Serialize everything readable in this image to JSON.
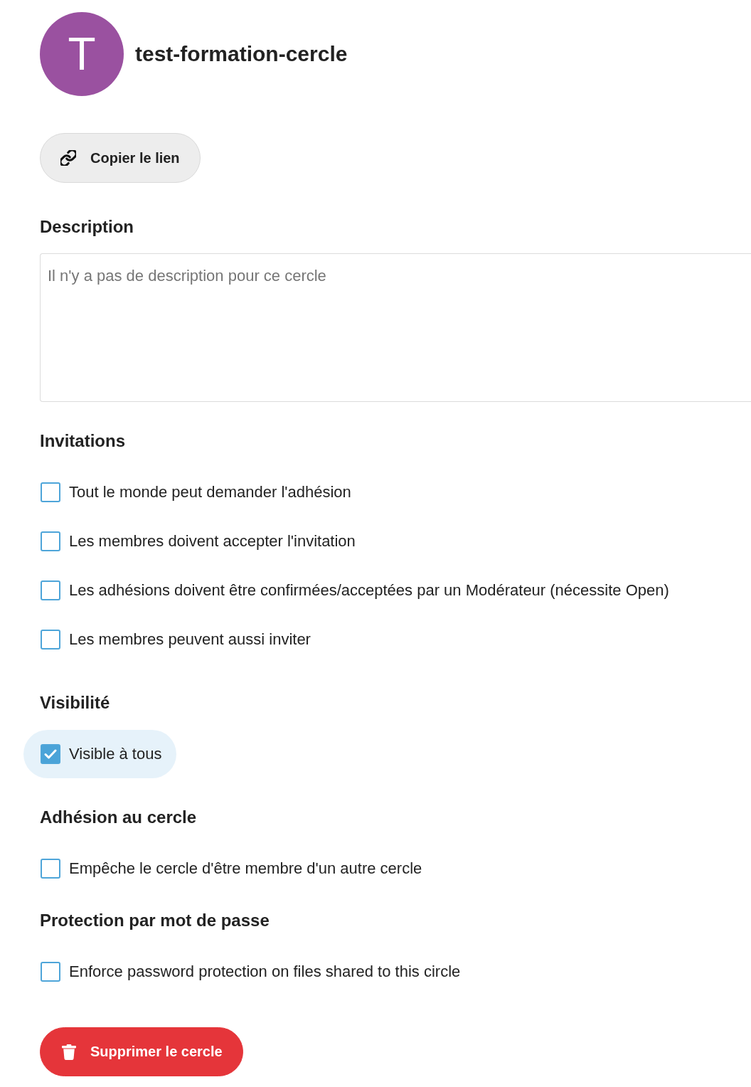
{
  "header": {
    "avatar_letter": "T",
    "title": "test-formation-cercle"
  },
  "copy_link_button": {
    "label": "Copier le lien"
  },
  "sections": [
    {
      "kind": "text",
      "heading": "Description",
      "placeholder": "Il n'y a pas de description pour ce cercle"
    },
    {
      "kind": "checkboxes",
      "heading": "Invitations",
      "options": [
        {
          "label": "Tout le monde peut demander l'adhésion",
          "checked": false
        },
        {
          "label": "Les membres doivent accepter l'invitation",
          "checked": false
        },
        {
          "label": "Les adhésions doivent être confirmées/acceptées par un Modérateur (nécessite Open)",
          "checked": false
        },
        {
          "label": "Les membres peuvent aussi inviter",
          "checked": false
        }
      ]
    },
    {
      "kind": "checkboxes",
      "heading": "Visibilité",
      "options": [
        {
          "label": "Visible à tous",
          "checked": true
        }
      ]
    },
    {
      "kind": "checkboxes",
      "heading": "Adhésion au cercle",
      "options": [
        {
          "label": "Empêche le cercle d'être membre d'un autre cercle",
          "checked": false
        }
      ]
    },
    {
      "kind": "checkboxes",
      "heading": "Protection par mot de passe",
      "options": [
        {
          "label": "Enforce password protection on files shared to this circle",
          "checked": false
        }
      ]
    }
  ],
  "delete_button": {
    "label": "Supprimer le cercle"
  }
}
